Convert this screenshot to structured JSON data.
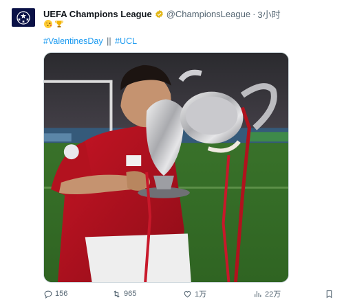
{
  "account": {
    "name": "UEFA Champions League",
    "handle": "@ChampionsLeague",
    "separator": "·",
    "time": "3小时",
    "avatar_icon": "champions-league-starball-icon",
    "verified_color": "#e2b719"
  },
  "tweet": {
    "emojis": [
      "face-blowing-kiss-emoji",
      "trophy-emoji"
    ],
    "hashtags": [
      "#ValentinesDay",
      "#UCL"
    ],
    "hashtag_separator": "||",
    "hashtag_color": "#1d9bf0"
  },
  "media": {
    "subject": "player-kissing-trophy-photo"
  },
  "actions": {
    "replies": "156",
    "retweets": "965",
    "likes": "1万",
    "views": "22万"
  },
  "colors": {
    "text": "#0f1419",
    "secondary": "#536471",
    "accent": "#1d9bf0"
  }
}
